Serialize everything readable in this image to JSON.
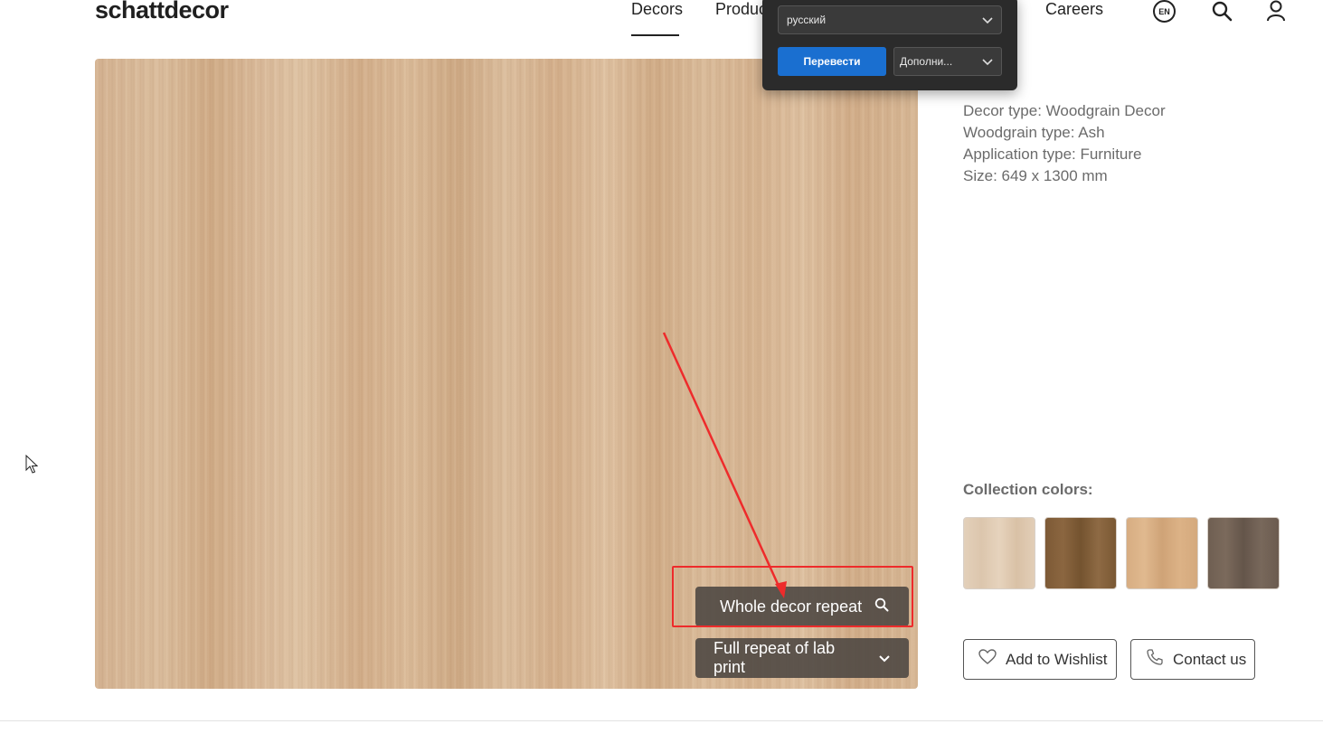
{
  "header": {
    "logo": "schattdecor",
    "nav": {
      "decors": "Decors",
      "products": "Produc",
      "careers": "Careers"
    },
    "language_badge": "EN",
    "icons": [
      "lang-icon",
      "search-icon",
      "user-icon"
    ]
  },
  "translate_popup": {
    "selected_language": "русский",
    "translate_label": "Перевести",
    "more_label": "Дополни..."
  },
  "decor_image": {
    "whole_repeat_label": "Whole decor repeat",
    "lab_print_label": "Full repeat of lab print"
  },
  "info": {
    "decor_type": "Decor type: Woodgrain Decor",
    "woodgrain_type": "Woodgrain type: Ash",
    "application_type": "Application type: Furniture",
    "size": "Size: 649 x 1300 mm"
  },
  "collection": {
    "title": "Collection colors:",
    "swatches": [
      "#e0ccb4",
      "#815d38",
      "#d8ae83",
      "#706052"
    ]
  },
  "actions": {
    "wishlist_label": "Add to Wishlist",
    "contact_label": "Contact us"
  },
  "annotation": {
    "color": "#ee2b2b"
  }
}
